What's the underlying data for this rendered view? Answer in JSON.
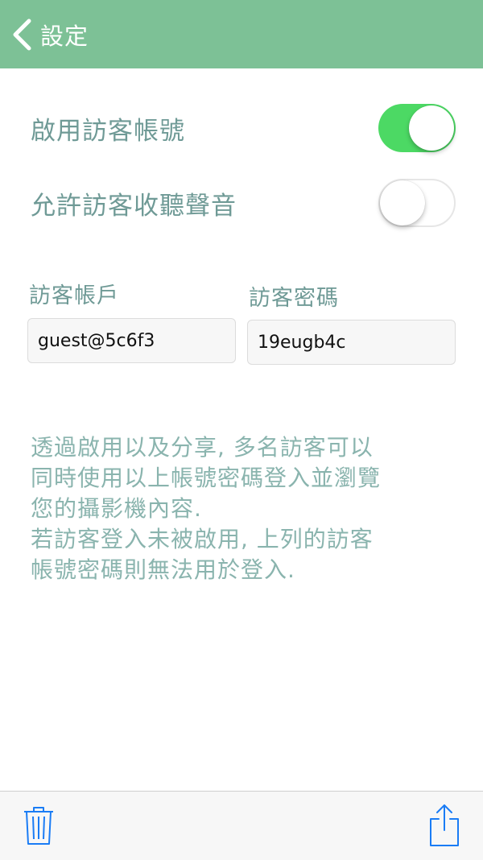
{
  "nav": {
    "back_icon": "chevron-left-icon",
    "title": "設定"
  },
  "settings": {
    "enable_guest": {
      "label": "啟用訪客帳號",
      "on": true
    },
    "allow_audio": {
      "label": "允許訪客收聽聲音",
      "on": false
    }
  },
  "credentials": {
    "account_label": "訪客帳戶",
    "account_value": "guest@5c6f3",
    "password_label": "訪客密碼",
    "password_value": "19eugb4c"
  },
  "description": {
    "lines": [
      "透過啟用以及分享, 多名訪客可以",
      "同時使用以上帳號密碼登入並瀏覽",
      "您的攝影機內容.",
      "若訪客登入未被啟用, 上列的訪客",
      "帳號密碼則無法用於登入."
    ]
  },
  "toolbar": {
    "delete_icon": "trash-icon",
    "share_icon": "share-icon"
  },
  "colors": {
    "nav_bg": "#7dc196",
    "label": "#6f9a96",
    "switch_on": "#4cd964",
    "icon_blue": "#1a7cf5"
  }
}
